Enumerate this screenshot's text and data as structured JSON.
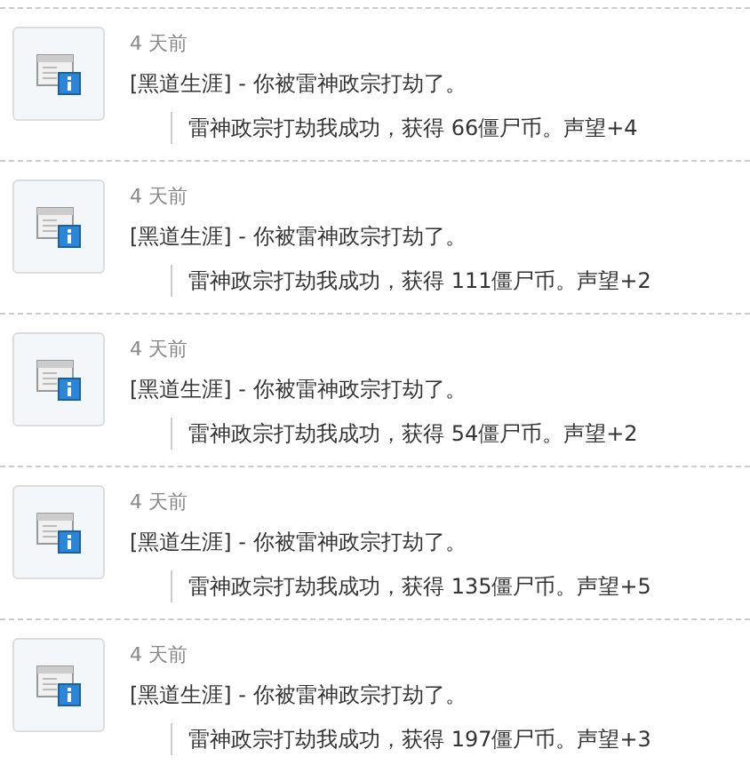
{
  "notifications": [
    {
      "time": "4 天前",
      "title": "[黑道生涯] - 你被雷神政宗打劫了。",
      "detail": "雷神政宗打劫我成功，获得 66僵尸币。声望+4"
    },
    {
      "time": "4 天前",
      "title": "[黑道生涯] - 你被雷神政宗打劫了。",
      "detail": "雷神政宗打劫我成功，获得 111僵尸币。声望+2"
    },
    {
      "time": "4 天前",
      "title": "[黑道生涯] - 你被雷神政宗打劫了。",
      "detail": "雷神政宗打劫我成功，获得 54僵尸币。声望+2"
    },
    {
      "time": "4 天前",
      "title": "[黑道生涯] - 你被雷神政宗打劫了。",
      "detail": "雷神政宗打劫我成功，获得 135僵尸币。声望+5"
    },
    {
      "time": "4 天前",
      "title": "[黑道生涯] - 你被雷神政宗打劫了。",
      "detail": "雷神政宗打劫我成功，获得 197僵尸币。声望+3"
    }
  ]
}
